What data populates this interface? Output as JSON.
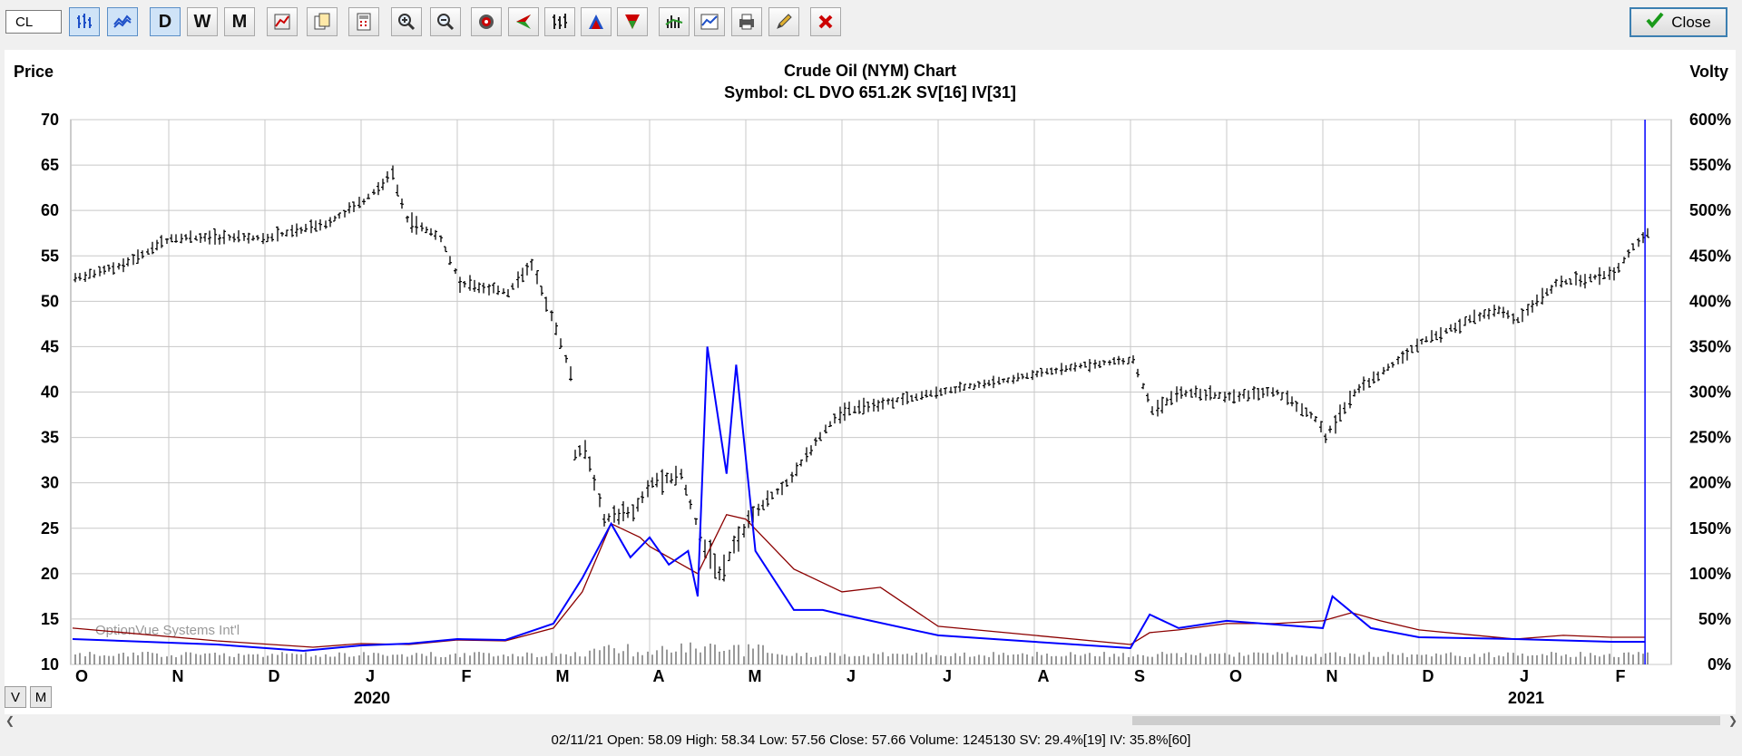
{
  "toolbar": {
    "symbol_value": "CL",
    "buttons": [
      {
        "name": "bar-chart-button",
        "label": "",
        "icon": "bar-chart-icon",
        "active": true
      },
      {
        "name": "volatility-lines-button",
        "label": "",
        "icon": "volatility-lines-icon",
        "active": true
      },
      {
        "name": "daily-button",
        "label": "D",
        "active": true
      },
      {
        "name": "weekly-button",
        "label": "W",
        "active": false
      },
      {
        "name": "monthly-button",
        "label": "M",
        "active": false
      },
      {
        "name": "chart-settings-button",
        "label": "",
        "icon": "chart-settings-icon"
      },
      {
        "name": "copy-button",
        "label": "",
        "icon": "copy-icon"
      },
      {
        "name": "calculator-button",
        "label": "",
        "icon": "calculator-icon"
      },
      {
        "name": "zoom-in-button",
        "label": "",
        "icon": "zoom-in-icon"
      },
      {
        "name": "zoom-out-button",
        "label": "",
        "icon": "zoom-out-icon"
      },
      {
        "name": "target-button",
        "label": "",
        "icon": "target-icon"
      },
      {
        "name": "triangle-left-button",
        "label": "",
        "icon": "arrow-left-icon"
      },
      {
        "name": "hlc-bars-button",
        "label": "",
        "icon": "hlc-bars-icon"
      },
      {
        "name": "volatility-up-button",
        "label": "",
        "icon": "triangle-up-icon"
      },
      {
        "name": "volatility-down-button",
        "label": "",
        "icon": "triangle-down-icon"
      },
      {
        "name": "indicator-button",
        "label": "",
        "icon": "indicator-icon"
      },
      {
        "name": "study-button",
        "label": "",
        "icon": "study-icon"
      },
      {
        "name": "print-button",
        "label": "",
        "icon": "print-icon"
      },
      {
        "name": "draw-button",
        "label": "",
        "icon": "pencil-icon"
      },
      {
        "name": "delete-button",
        "label": "",
        "icon": "delete-icon"
      }
    ],
    "close_label": "Close"
  },
  "view_toggles": [
    "V",
    "M"
  ],
  "status_bar": "02/11/21  Open: 58.09  High: 58.34  Low: 57.56  Close: 57.66  Volume: 1245130  SV: 29.4%[19]  IV: 35.8%[60]",
  "colors": {
    "price_bars": "#000000",
    "statistical_volatility": "#0000ff",
    "implied_volatility": "#8b0000",
    "grid": "#c8c8c8",
    "cursor_line": "#0000ff"
  },
  "chart_data": {
    "type": "bar",
    "title": "Crude Oil (NYM) Chart",
    "subtitle": "Symbol: CL  DVO 651.2K  SV[16]  IV[31]",
    "ylabel": "Price",
    "y2label": "Volty",
    "watermark": "OptionVue Systems Int'l",
    "ylim": [
      10,
      70
    ],
    "y_ticks": [
      10,
      15,
      20,
      25,
      30,
      35,
      40,
      45,
      50,
      55,
      60,
      65,
      70
    ],
    "y2lim": [
      0,
      600
    ],
    "y2_ticks": [
      "0%",
      "50%",
      "100%",
      "150%",
      "200%",
      "250%",
      "300%",
      "350%",
      "400%",
      "450%",
      "500%",
      "550%",
      "600%"
    ],
    "month_labels": [
      "O",
      "N",
      "D",
      "J",
      "F",
      "M",
      "A",
      "M",
      "J",
      "J",
      "A",
      "S",
      "O",
      "N",
      "D",
      "J",
      "F"
    ],
    "year_labels": [
      {
        "text": "2020",
        "month_index": 3
      },
      {
        "text": "2021",
        "month_index": 15
      }
    ],
    "grid": true,
    "price_anchors": [
      [
        0,
        52.5
      ],
      [
        0.5,
        54
      ],
      [
        1,
        57
      ],
      [
        2,
        57
      ],
      [
        2.6,
        58.5
      ],
      [
        3,
        61
      ],
      [
        3.3,
        64
      ],
      [
        3.45,
        59
      ],
      [
        3.8,
        57
      ],
      [
        4,
        52
      ],
      [
        4.5,
        51
      ],
      [
        4.75,
        54
      ],
      [
        5,
        47
      ],
      [
        5.15,
        42
      ],
      [
        5.18,
        33
      ],
      [
        5.3,
        34
      ],
      [
        5.5,
        26
      ],
      [
        5.8,
        27
      ],
      [
        6,
        30
      ],
      [
        6.3,
        31
      ],
      [
        6.5,
        24
      ],
      [
        6.7,
        20
      ],
      [
        7,
        26
      ],
      [
        7.4,
        30
      ],
      [
        7.8,
        36
      ],
      [
        8,
        38
      ],
      [
        8.5,
        39
      ],
      [
        9,
        40
      ],
      [
        9.5,
        41
      ],
      [
        10,
        42
      ],
      [
        10.5,
        43
      ],
      [
        11,
        43.5
      ],
      [
        11.2,
        38
      ],
      [
        11.5,
        40
      ],
      [
        12,
        39.5
      ],
      [
        12.5,
        40
      ],
      [
        12.9,
        37
      ],
      [
        13,
        35
      ],
      [
        13.3,
        40
      ],
      [
        13.7,
        43
      ],
      [
        14,
        45.5
      ],
      [
        14.5,
        48
      ],
      [
        14.8,
        49
      ],
      [
        15,
        48
      ],
      [
        15.4,
        52
      ],
      [
        15.7,
        52.5
      ],
      [
        16,
        53
      ],
      [
        16.2,
        56
      ],
      [
        16.4,
        58
      ]
    ],
    "statistical_volatility": [
      [
        0,
        28
      ],
      [
        1.5,
        22
      ],
      [
        2.4,
        15
      ],
      [
        3,
        21
      ],
      [
        3.5,
        23
      ],
      [
        4,
        28
      ],
      [
        4.5,
        27
      ],
      [
        5,
        45
      ],
      [
        5.3,
        95
      ],
      [
        5.6,
        155
      ],
      [
        5.8,
        118
      ],
      [
        6,
        140
      ],
      [
        6.2,
        110
      ],
      [
        6.4,
        125
      ],
      [
        6.5,
        75
      ],
      [
        6.6,
        350
      ],
      [
        6.8,
        210
      ],
      [
        6.9,
        330
      ],
      [
        7.1,
        125
      ],
      [
        7.5,
        60
      ],
      [
        7.8,
        60
      ],
      [
        8,
        55
      ],
      [
        9,
        32
      ],
      [
        10,
        25
      ],
      [
        11,
        18
      ],
      [
        11.2,
        55
      ],
      [
        11.5,
        40
      ],
      [
        12,
        48
      ],
      [
        13,
        40
      ],
      [
        13.1,
        75
      ],
      [
        13.5,
        40
      ],
      [
        14,
        30
      ],
      [
        15,
        28
      ],
      [
        16,
        25
      ],
      [
        16.35,
        25
      ]
    ],
    "implied_volatility": [
      [
        0,
        40
      ],
      [
        1.5,
        26
      ],
      [
        2.5,
        19
      ],
      [
        3,
        23
      ],
      [
        3.5,
        22
      ],
      [
        4,
        27
      ],
      [
        4.5,
        26
      ],
      [
        5,
        40
      ],
      [
        5.3,
        80
      ],
      [
        5.6,
        155
      ],
      [
        5.9,
        140
      ],
      [
        6,
        130
      ],
      [
        6.5,
        100
      ],
      [
        6.8,
        165
      ],
      [
        7,
        160
      ],
      [
        7.5,
        105
      ],
      [
        8,
        80
      ],
      [
        8.4,
        85
      ],
      [
        9,
        42
      ],
      [
        10,
        32
      ],
      [
        11,
        22
      ],
      [
        11.2,
        35
      ],
      [
        11.5,
        38
      ],
      [
        12,
        45
      ],
      [
        12.5,
        45
      ],
      [
        13,
        48
      ],
      [
        13.3,
        57
      ],
      [
        13.6,
        48
      ],
      [
        14,
        38
      ],
      [
        15,
        28
      ],
      [
        15.5,
        32
      ],
      [
        16,
        30
      ],
      [
        16.35,
        30
      ]
    ]
  }
}
